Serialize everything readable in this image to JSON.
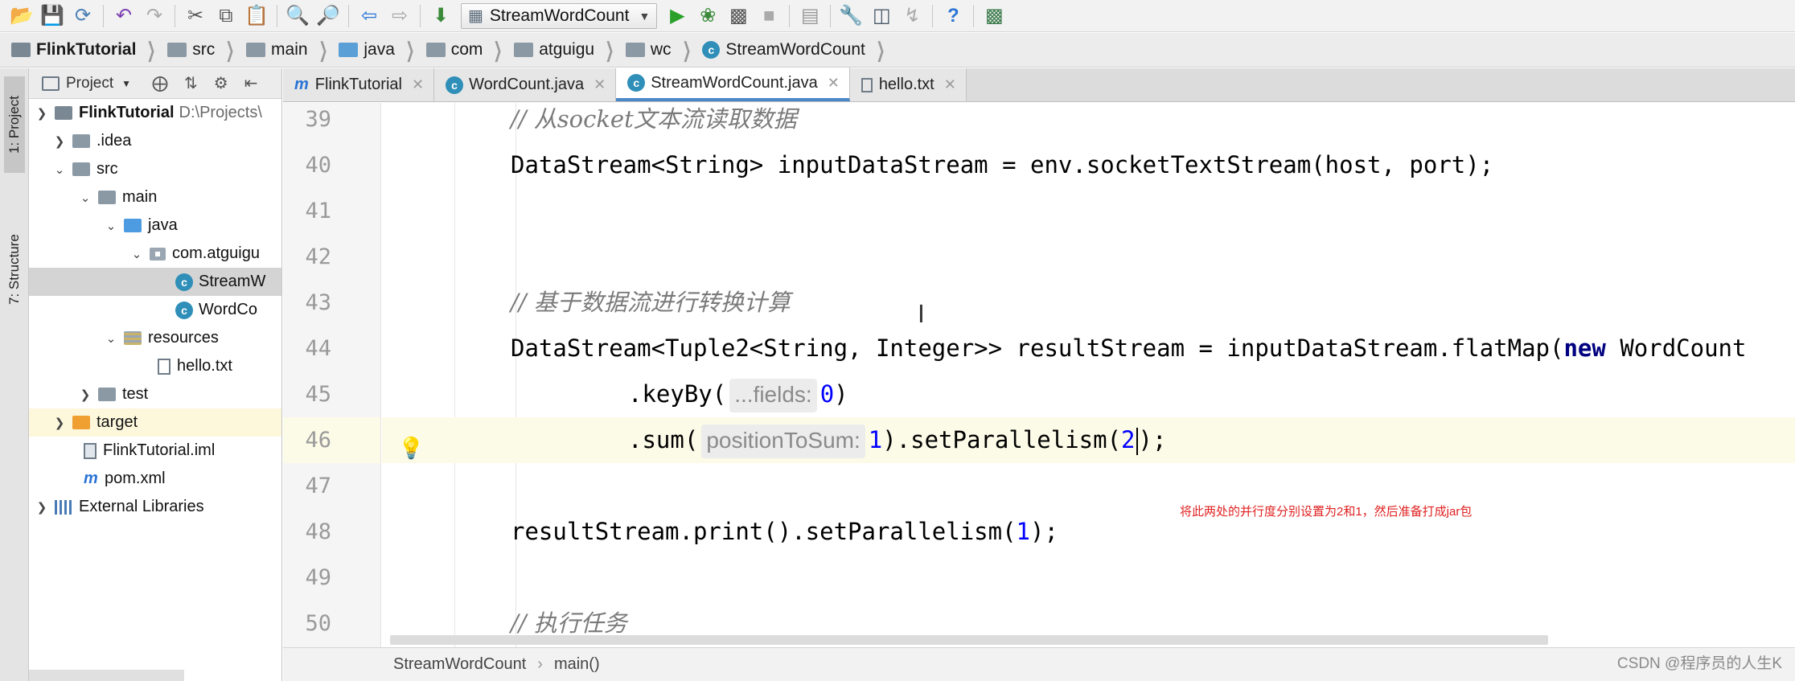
{
  "toolbar": {
    "run_config": "StreamWordCount",
    "buttons": [
      "open-icon",
      "save-icon",
      "sync-icon",
      "undo-icon",
      "redo-icon",
      "cut-icon",
      "copy-icon",
      "paste-icon",
      "find-icon",
      "replace-icon",
      "back-icon",
      "forward-icon",
      "build-icon",
      "run-icon",
      "debug-icon",
      "coverage-icon",
      "stop-icon",
      "project-structure-icon",
      "settings-icon",
      "sdk-icon",
      "vcs-icon",
      "help-icon",
      "terminal-icon"
    ]
  },
  "navbar": {
    "crumbs": [
      "FlinkTutorial",
      "src",
      "main",
      "java",
      "com",
      "atguigu",
      "wc",
      "StreamWordCount"
    ]
  },
  "tool_strip": {
    "project_tab": "1: Project",
    "structure_tab": "7: Structure"
  },
  "project_panel": {
    "title": "Project",
    "tree": [
      {
        "label": "FlinkTutorial",
        "extra": "D:\\Projects\\",
        "bold": true
      },
      {
        "label": ".idea"
      },
      {
        "label": "src"
      },
      {
        "label": "main"
      },
      {
        "label": "java"
      },
      {
        "label": "com.atguigu"
      },
      {
        "label": "StreamW"
      },
      {
        "label": "WordCo"
      },
      {
        "label": "resources"
      },
      {
        "label": "hello.txt"
      },
      {
        "label": "test"
      },
      {
        "label": "target"
      },
      {
        "label": "FlinkTutorial.iml"
      },
      {
        "label": "pom.xml"
      },
      {
        "label": "External Libraries"
      }
    ]
  },
  "editor_tabs": [
    {
      "label": "FlinkTutorial"
    },
    {
      "label": "WordCount.java"
    },
    {
      "label": "StreamWordCount.java",
      "active": true
    },
    {
      "label": "hello.txt"
    }
  ],
  "line_numbers": [
    "39",
    "40",
    "41",
    "42",
    "43",
    "44",
    "45",
    "46",
    "47",
    "48",
    "49",
    "50"
  ],
  "code": {
    "l39": "// 从socket文本流读取数据",
    "l40": "DataStream<String> inputDataStream = env.socketTextStream(host, port);",
    "l43": "// 基于数据流进行转换计算",
    "l44_a": "DataStream<Tuple2<String, Integer>> resultStream = inputDataStream.flatMap(",
    "l44_kw": "new",
    "l44_b": " WordCount",
    "l45_a": ".keyBy(",
    "l45_hint": "...fields:",
    "l45_num": "0",
    "l45_b": ")",
    "l46_a": ".sum(",
    "l46_hint": "positionToSum:",
    "l46_num1": "1",
    "l46_b": ").setParallelism(",
    "l46_num2": "2",
    "l46_c": ");",
    "l48_a": "resultStream.print().setParallelism(",
    "l48_num": "1",
    "l48_b": ");",
    "l50": "// 执行任务"
  },
  "annotation": "将此两处的并行度分别设置为2和1，然后准备打成jar包",
  "editor_crumbs": [
    "StreamWordCount",
    "main()"
  ],
  "watermark": "CSDN @程序员的人生K"
}
